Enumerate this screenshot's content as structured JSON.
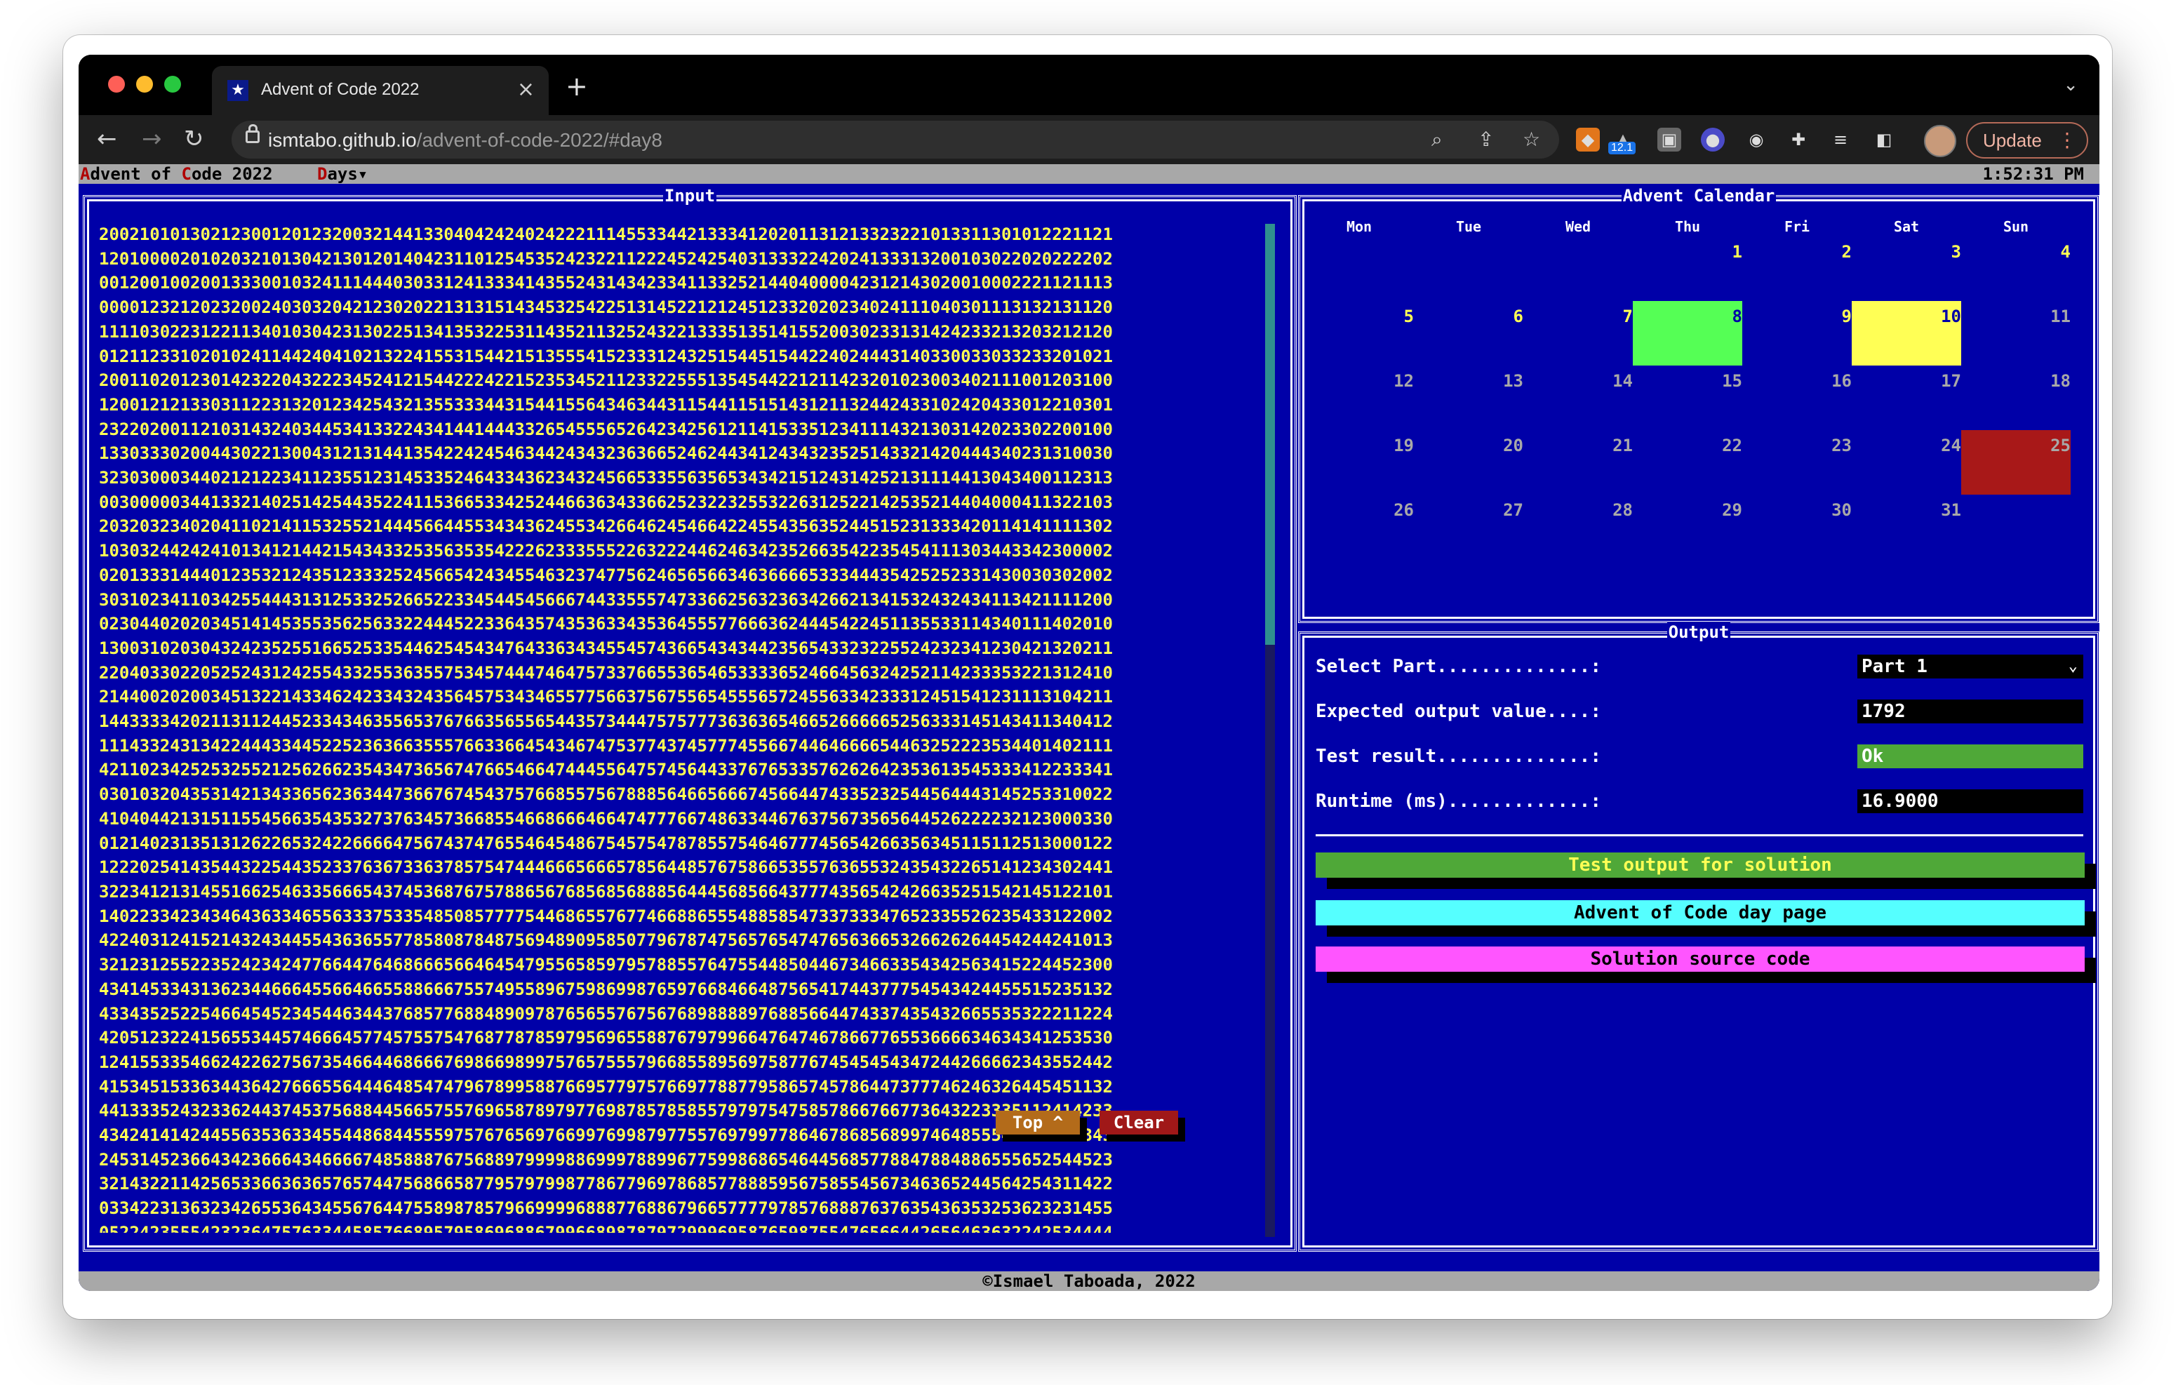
{
  "browser": {
    "tab_title": "Advent of Code 2022",
    "tab_favicon": "★",
    "tab_close": "×",
    "new_tab": "+",
    "url_host": "ismtabo.github.io",
    "url_path": "/advent-of-code-2022/#day8",
    "extension_badge": "12.1",
    "update_label": "Update",
    "icons": [
      "back-icon",
      "forward-icon",
      "reload-icon",
      "lock-icon",
      "zoom-icon",
      "share-icon",
      "bookmark-star-icon",
      "metamask-icon",
      "extension-icon",
      "screen-capture-icon",
      "ublock-icon",
      "camera-icon",
      "puzzle-extensions-icon",
      "reading-list-icon",
      "sidebar-icon",
      "profile-avatar",
      "kebab-menu-icon"
    ]
  },
  "menubar": {
    "title_a": "A",
    "title_b": "dvent of ",
    "title_c": "C",
    "title_d": "ode 2022",
    "days_a": "D",
    "days_b": "ays▾",
    "clock": "1:52:31 PM"
  },
  "input_panel": {
    "title": "Input",
    "lines": [
      "2002101013021230012012320032144133040424240242221114553344213334120201131213323221013311301012221121",
      "1201000020102032101304213012014042311012545352423221122245242540313332242024133313200103022020222202",
      "0012001002001333001032411144403033124133341435524314342334113325214404000042312143020010002221121113",
      "0000123212023200240303204212302022131315143453254225131452212124512332020234024111040301113132131120",
      "1111030223122113401030423130225134135322531143521132524322133351351415520030233131424233213203212120",
      "0121123310201024114424041021322415531544215135554152333124325154451544224024443140330033033233201021",
      "2001102012301423220432223452412154422242215235345211233225551354544221211423201023003402111001203100",
      "1200121213303112231320123425432135533344315441556434634431154411515143121132442433102420433012210301",
      "2322020011210314324034453413322434144144433265455565264234256121141533512341114321303142023302200100",
      "1330333020044302213004312131441354224245463442434323636652462443412434323525143321420444340231310030",
      "3230300034402121223411235512314533524643343623432456653355635653434215124314252131114413043400112313",
      "0030000034413321402514254435224115366533425244663634336625232232553226312522142535214404000411322103",
      "2032032340204110214115325521444566445534343624553426646245466422455435635244515231333420114141111302",
      "1030324424241013412144215434332535635354222623335552263222446246342352663542235454111303443342300002",
      "0201333144401235321243512333252456654243455463237477562465656634636666533344435425252331430030302002",
      "3031023411034255444313125332526652233454454566674433555747336625632363426621341532432434113421111200",
      "0230440202034514145355356256332244452233643574353633435364555776663624445422451135533114340111402010",
      "1300310203043242352551665253354462545434764336343455457436654343442356543323225524232341230421320211",
      "2204033022052524312425543325536355753457444746475733766553654653333652466456324252114233353221312410",
      "2144002020034513221433462423343243564575343465577566375675565455565724556334233312451541231113104211",
      "1443333420211311244523343463556537676635655654435734447575777363636546652666665256333145143411340412",
      "1114332431342244433445225236366355576633664543467475377437457774556674464666654463252223534401402111",
      "4211023425253255212562662354347365674766546647444556475745644337676533576262642353613545333412233341",
      "0301032043531421343365623634473667674543757668557567888564665666745664474335232544564443145253310022",
      "4104044213151155456635435327376345736685546686664664747776674863344676375673565644526222232123000330",
      "0121402313513126226532422666647567437476554645486754575478785575464677745654266356345115112513000122",
      "1222025414354432254435233763673363785754744466656665785644857675866535576365532435432265141234302441",
      "3223412131455166254633566654374536876757886567685685688856444568566437774356542426635251542145122101",
      "1402233423434643633465563337533548508577775446865576774668865554885854733733347652335526235433122002",
      "4224031241521432434455436365577858087848756948909585077967874756576547476563665326626264454244241013",
      "3212312552235242342477664476468666566464547955658597957885576475544850446734663354342563415224452300",
      "4341453343136234466645566466558866675574955896759869987659766846648756541744377754543424455515235132",
      "4334352522546645452345446344376857768848909787656557675676898888976885664474337435432665535322211224",
      "4205123224156553445746664577457557547687787859795696558876797996647647467866776553666634634341253530",
      "1241553354662422627567354664468666769866989975765755579668558956975877674545454347244266662343552442",
      "4153451533634436427666556444648547479678995887669577975766977887795865745786447377746246326445451132",
      "4413335243233624437453756884456657557696587897977698785785855797975475857866766773643223335112414233",
      "4342414142445563536334554486844555975767656976699769987977557697997786467868568997464855545445514343",
      "2453145236643423666434666674858887675688979999886999788996775998686546445685778847884886555652544523",
      "3214322114256533663636576574475686658779579799877867796978685778885956758554567346365244564254311422",
      "0334223136323426553643455676447558987857966999968887768867966577779785768887637635436353253623231455",
      "0522423555423236475763344585766895795869688679966898787972999695876598755476566442656463632242534444"
    ],
    "top_label": "Top ^",
    "clear_label": "Clear"
  },
  "calendar": {
    "title": "Advent Calendar",
    "weekdays": [
      "Mon",
      "Tue",
      "Wed",
      "Thu",
      "Fri",
      "Sat",
      "Sun"
    ],
    "days": [
      {
        "label": "1",
        "status": "available"
      },
      {
        "label": "2",
        "status": "available"
      },
      {
        "label": "3",
        "status": "available"
      },
      {
        "label": "4",
        "status": "available"
      },
      {
        "label": "5",
        "status": "available"
      },
      {
        "label": "6",
        "status": "available"
      },
      {
        "label": "7",
        "status": "available"
      },
      {
        "label": "8",
        "status": "selected-green"
      },
      {
        "label": "9",
        "status": "available"
      },
      {
        "label": "10",
        "status": "today-yellow"
      },
      {
        "label": "11",
        "status": "locked"
      },
      {
        "label": "12",
        "status": "locked"
      },
      {
        "label": "13",
        "status": "locked"
      },
      {
        "label": "14",
        "status": "locked"
      },
      {
        "label": "15",
        "status": "locked"
      },
      {
        "label": "16",
        "status": "locked"
      },
      {
        "label": "17",
        "status": "locked"
      },
      {
        "label": "18",
        "status": "locked"
      },
      {
        "label": "19",
        "status": "locked"
      },
      {
        "label": "20",
        "status": "locked"
      },
      {
        "label": "21",
        "status": "locked"
      },
      {
        "label": "22",
        "status": "locked"
      },
      {
        "label": "23",
        "status": "locked"
      },
      {
        "label": "24",
        "status": "locked"
      },
      {
        "label": "25",
        "status": "christmas-red"
      },
      {
        "label": "26",
        "status": "locked"
      },
      {
        "label": "27",
        "status": "locked"
      },
      {
        "label": "28",
        "status": "locked"
      },
      {
        "label": "29",
        "status": "locked"
      },
      {
        "label": "30",
        "status": "locked"
      },
      {
        "label": "31",
        "status": "locked"
      }
    ]
  },
  "output": {
    "title": "Output",
    "select_part_label": "Select Part..............:",
    "select_part_value": "Part 1",
    "expected_label": "Expected output value....:",
    "expected_value": "1792",
    "test_result_label": "Test result..............:",
    "test_result_value": "Ok",
    "runtime_label": "Runtime (ms).............:",
    "runtime_value": "16.9000",
    "btn_test": "Test output for solution",
    "btn_day_page": "Advent of Code day page",
    "btn_source": "Solution source code"
  },
  "footer": {
    "copyright": "©Ismael Taboada, 2022"
  },
  "colors": {
    "background_blue": "#0000a8",
    "digit_yellow": "#ffff55",
    "ok_green": "#4fa838",
    "cyan": "#55ffff",
    "magenta": "#ff55ff",
    "red": "#a81818"
  }
}
